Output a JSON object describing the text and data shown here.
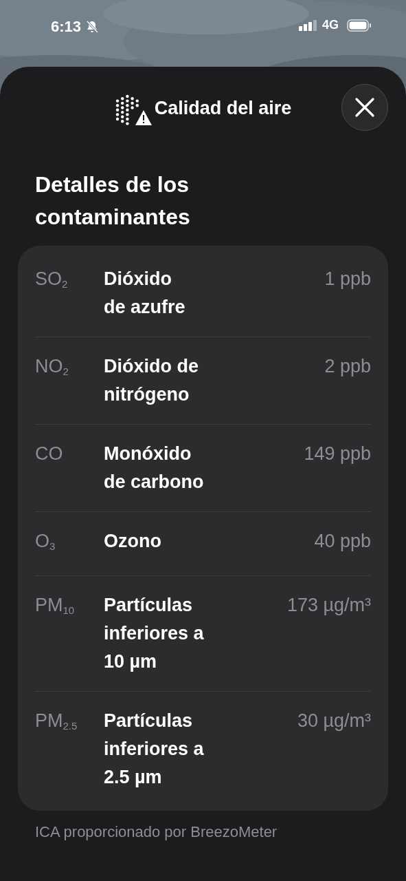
{
  "status_bar": {
    "time": "6:13",
    "network": "4G"
  },
  "header": {
    "title": "Calidad del aire"
  },
  "heading": "Detalles de los contaminantes",
  "pollutants": [
    {
      "symbol": "SO$_{2}$",
      "name": "Dióxido\nde azufre",
      "value": "1 ppb"
    },
    {
      "symbol": "NO$_{2}$",
      "name": "Dióxido de\nnitrógeno",
      "value": "2 ppb"
    },
    {
      "symbol": "CO",
      "name": "Monóxido\nde carbono",
      "value": "149 ppb"
    },
    {
      "symbol": "O$_{3}$",
      "name": "Ozono",
      "value": "40 ppb"
    },
    {
      "symbol": "PM$_{10}$",
      "name": "Partículas\ninferiores a\n10 µm",
      "value": "173 µg/m³"
    },
    {
      "symbol": "PM$_{2.5}$",
      "name": "Partículas\ninferiores a\n2.5 µm",
      "value": "30 µg/m³"
    }
  ],
  "footer": "ICA proporcionado por BreezoMeter"
}
